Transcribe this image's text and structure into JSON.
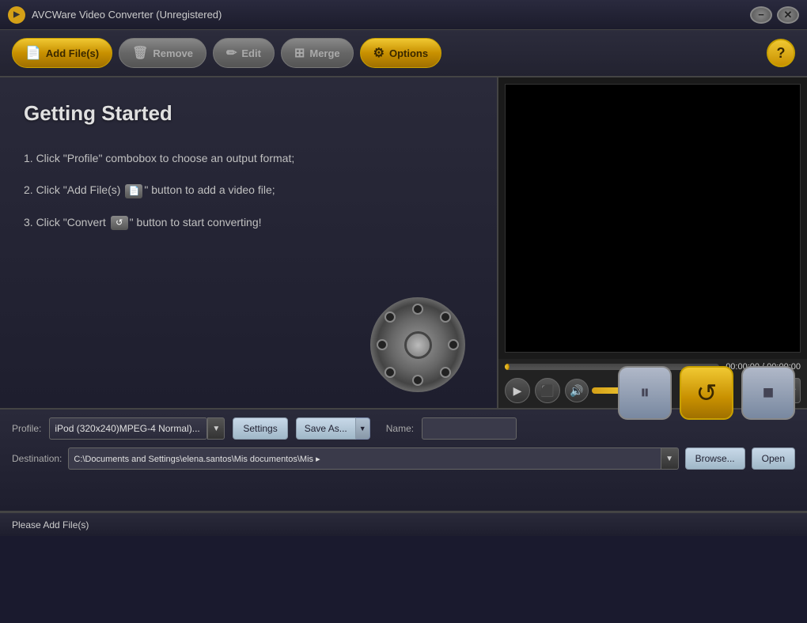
{
  "app": {
    "title": "AVCWare Video Converter (Unregistered)",
    "icon": "▶"
  },
  "titlebar": {
    "minimize_label": "−",
    "close_label": "✕"
  },
  "toolbar": {
    "add_files_label": "Add File(s)",
    "remove_label": "Remove",
    "edit_label": "Edit",
    "merge_label": "Merge",
    "options_label": "Options",
    "help_label": "?"
  },
  "getting_started": {
    "title": "Getting Started",
    "step1": "1. Click \"Profile\" combobox to choose an output format;",
    "step2": "2. Click \"Add File(s)  \" button to add a video file;",
    "step3": "3. Click \"Convert  \" button to start converting!"
  },
  "video_player": {
    "time_display": "00:00:00 / 00:00:00",
    "progress": 0,
    "volume": 55
  },
  "profile_section": {
    "label": "Profile:",
    "selected": "iPod (320x240)MPEG-4 Normal)...",
    "settings_label": "Settings",
    "save_as_label": "Save As...",
    "name_label": "Name:",
    "name_value": ""
  },
  "destination_section": {
    "label": "Destination:",
    "path": "C:\\Documents and Settings\\elena.santos\\Mis documentos\\Mis ▸",
    "browse_label": "Browse...",
    "open_label": "Open"
  },
  "convert_buttons": {
    "pause_icon": "⏸",
    "convert_icon": "↺",
    "stop_icon": "■"
  },
  "statusbar": {
    "text": "Please Add File(s)"
  },
  "colors": {
    "accent": "#f0c832",
    "bg_dark": "#1a1a2e",
    "bg_medium": "#252535",
    "toolbar_bg": "#2c2c3c"
  }
}
